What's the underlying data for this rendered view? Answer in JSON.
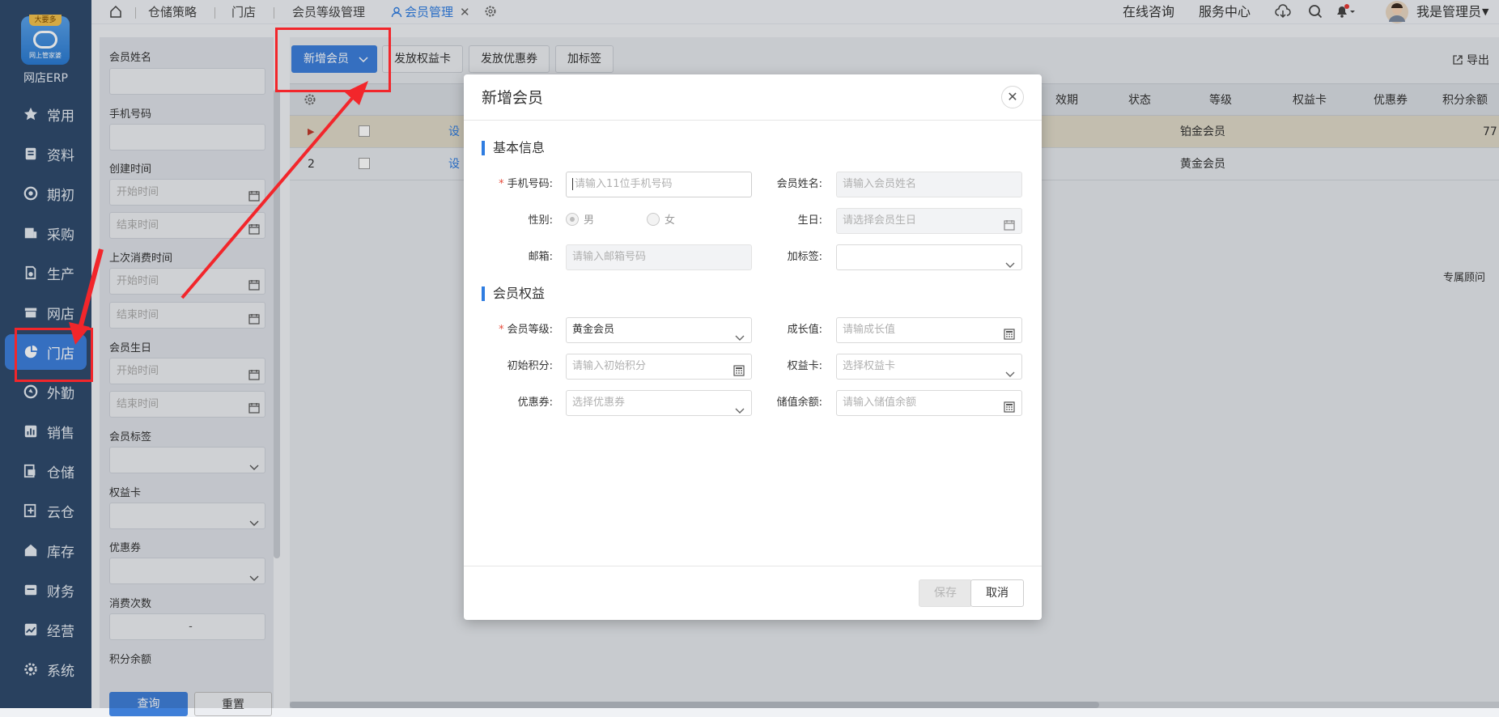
{
  "app": {
    "name": "网店ERP",
    "logo_badge": "大要多",
    "logo_sub": "网上管家婆"
  },
  "nav": [
    {
      "label": "常用",
      "icon": "star-icon"
    },
    {
      "label": "资料",
      "icon": "document-icon"
    },
    {
      "label": "期初",
      "icon": "target-icon"
    },
    {
      "label": "采购",
      "icon": "purchase-icon"
    },
    {
      "label": "生产",
      "icon": "production-icon"
    },
    {
      "label": "网店",
      "icon": "shop-icon"
    },
    {
      "label": "门店",
      "icon": "pie-chart-icon"
    },
    {
      "label": "外勤",
      "icon": "field-icon"
    },
    {
      "label": "销售",
      "icon": "sales-chart-icon"
    },
    {
      "label": "仓储",
      "icon": "warehouse-icon"
    },
    {
      "label": "云仓",
      "icon": "cloud-warehouse-icon"
    },
    {
      "label": "库存",
      "icon": "inventory-icon"
    },
    {
      "label": "财务",
      "icon": "finance-icon"
    },
    {
      "label": "经营",
      "icon": "operation-icon"
    },
    {
      "label": "系统",
      "icon": "gear-icon"
    }
  ],
  "tabs": [
    {
      "label": "仓储策略"
    },
    {
      "label": "门店"
    },
    {
      "label": "会员等级管理"
    },
    {
      "label": "会员管理"
    }
  ],
  "top_right": {
    "consult": "在线咨询",
    "service": "服务中心",
    "user": "我是管理员"
  },
  "filter": {
    "name_label": "会员姓名",
    "phone_label": "手机号码",
    "created_label": "创建时间",
    "last_consume_label": "上次消费时间",
    "birthday_label": "会员生日",
    "tag_label": "会员标签",
    "card_label": "权益卡",
    "coupon_label": "优惠券",
    "count_label": "消费次数",
    "points_label": "积分余额",
    "start_ph": "开始时间",
    "end_ph": "结束时间",
    "count_dash": "-",
    "query": "查询",
    "reset": "重置"
  },
  "toolbar": {
    "add_member": "新增会员",
    "grant_card": "发放权益卡",
    "grant_coupon": "发放优惠券",
    "add_tag": "加标签",
    "export": "导出"
  },
  "grid": {
    "headers": [
      "效期",
      "状态",
      "等级",
      "权益卡",
      "优惠券",
      "积分余额"
    ],
    "rows": [
      {
        "num": "▶",
        "link": "设",
        "level": "铂金会员",
        "points": "77"
      },
      {
        "num": "2",
        "link": "设",
        "level": "黄金会员",
        "points": ""
      }
    ],
    "advisor": "专属顾问"
  },
  "modal": {
    "title": "新增会员",
    "section_basic": "基本信息",
    "section_rights": "会员权益",
    "phone_label": "手机号码:",
    "phone_ph": "请输入11位手机号码",
    "name_label": "会员姓名:",
    "name_ph": "请输入会员姓名",
    "gender_label": "性别:",
    "male": "男",
    "female": "女",
    "birthday_label": "生日:",
    "birthday_ph": "请选择会员生日",
    "email_label": "邮箱:",
    "email_ph": "请输入邮箱号码",
    "tag_label": "加标签:",
    "level_label": "会员等级:",
    "level_value": "黄金会员",
    "growth_label": "成长值:",
    "growth_ph": "请输成长值",
    "init_points_label": "初始积分:",
    "init_points_ph": "请输入初始积分",
    "card_label": "权益卡:",
    "card_ph": "选择权益卡",
    "coupon_label": "优惠券:",
    "coupon_ph": "选择优惠券",
    "balance_label": "储值余额:",
    "balance_ph": "请输入储值余额",
    "save": "保存",
    "cancel": "取消"
  }
}
